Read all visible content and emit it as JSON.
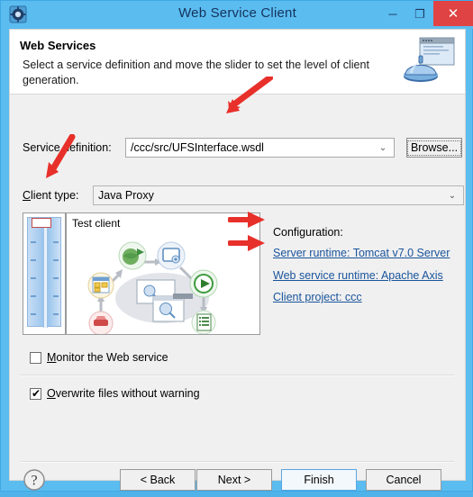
{
  "window": {
    "title": "Web Service Client",
    "app_icon": "gear-icon",
    "controls": {
      "minimize": "─",
      "maximize": "❐",
      "close": "✕"
    }
  },
  "header": {
    "title": "Web Services",
    "description": "Select a service definition and move the slider to set the level of client generation.",
    "banner_icon": "web-service-banner-icon"
  },
  "form": {
    "service_definition_label": "Service definition:",
    "service_definition_value": "/ccc/src/UFSInterface.wsdl",
    "browse_label": "Browse...",
    "client_type_label": "Client type:",
    "client_type_value": "Java Proxy",
    "dropdown_arrow": "⌄"
  },
  "slider": {
    "name": "client-generation-slider",
    "thumb_position": "top"
  },
  "test_client": {
    "label": "Test client"
  },
  "configuration": {
    "title": "Configuration:",
    "links": [
      {
        "id": "server-runtime",
        "label": "Server runtime: Tomcat v7.0 Server"
      },
      {
        "id": "web-service-runtime",
        "label": "Web service runtime: Apache Axis"
      },
      {
        "id": "client-project",
        "label": "Client project: ccc"
      }
    ]
  },
  "options": [
    {
      "id": "monitor-web-service",
      "label": "Monitor the Web service",
      "checked": false,
      "mark": ""
    },
    {
      "id": "overwrite-files",
      "label": "Overwrite files without warning",
      "checked": true,
      "mark": "✔"
    }
  ],
  "buttons": {
    "back": "< Back",
    "next": "Next >",
    "finish": "Finish",
    "cancel": "Cancel",
    "help_icon": "help-question-icon"
  },
  "colors": {
    "titlebar": "#5bbcf0",
    "close_button": "#e04343",
    "dialog_background": "#f0f0f0",
    "link": "#19549c",
    "annotation_arrow": "#e8302a",
    "default_button_border": "#5aa5e0"
  },
  "annotations": [
    {
      "id": "arrow-service-definition",
      "points_to": "service-definition-combo"
    },
    {
      "id": "arrow-client-type",
      "points_to": "client-type-combo"
    },
    {
      "id": "arrow-slider",
      "points_to": "client-generation-slider"
    },
    {
      "id": "arrow-server-runtime",
      "points_to": "server-runtime-link"
    },
    {
      "id": "arrow-web-service-runtime",
      "points_to": "web-service-runtime-link"
    }
  ]
}
